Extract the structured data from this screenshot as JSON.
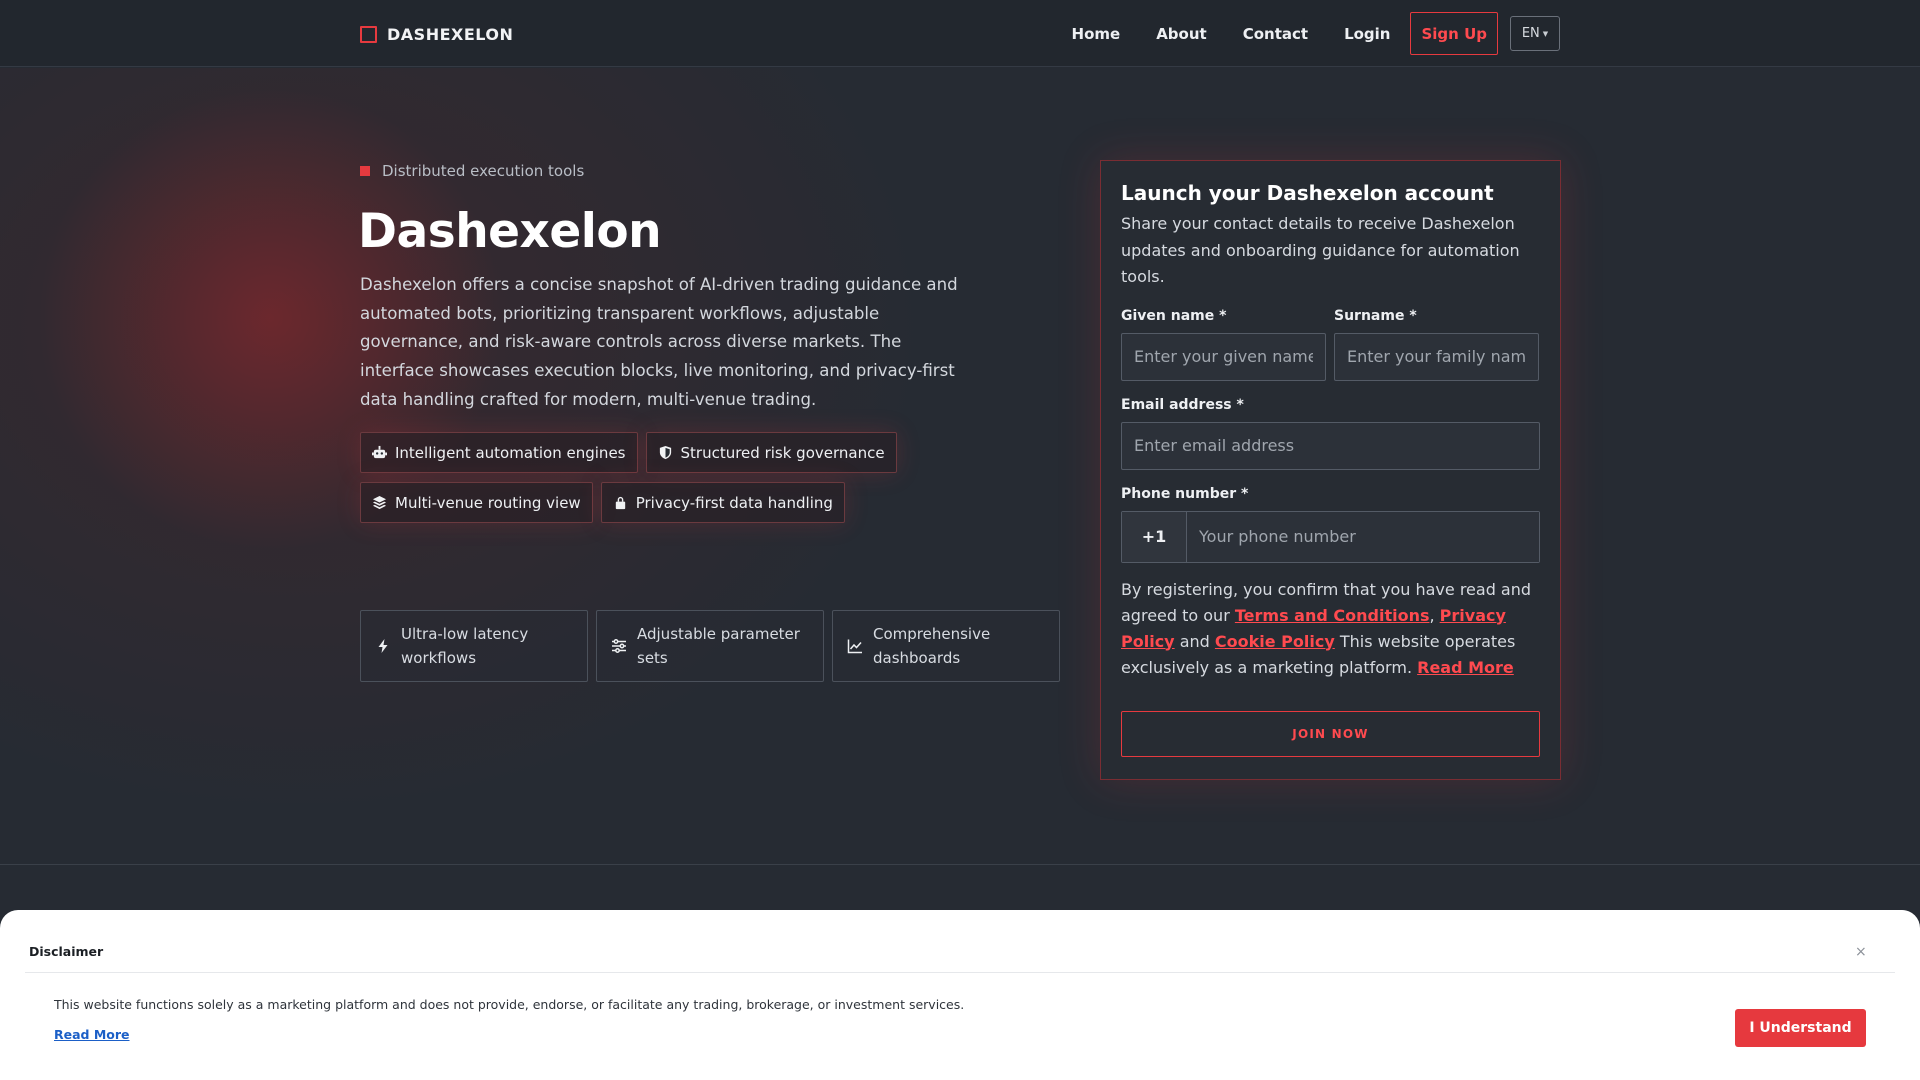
{
  "header": {
    "brand": "DASHEXELON",
    "nav": [
      "Home",
      "About",
      "Contact",
      "Login"
    ],
    "signup": "Sign Up",
    "language": "EN"
  },
  "hero": {
    "eyebrow": "Distributed execution tools",
    "title": "Dashexelon",
    "description": "Dashexelon offers a concise snapshot of AI-driven trading guidance and automated bots, prioritizing transparent workflows, adjustable governance, and risk-aware controls across diverse markets. The interface showcases execution blocks, live monitoring, and privacy-first data handling crafted for modern, multi-venue trading.",
    "chips": [
      {
        "label": "Intelligent automation engines",
        "icon": "robot-icon"
      },
      {
        "label": "Structured risk governance",
        "icon": "shield-icon"
      },
      {
        "label": "Multi-venue routing view",
        "icon": "layers-icon"
      },
      {
        "label": "Privacy-first data handling",
        "icon": "lock-icon"
      }
    ],
    "features": [
      {
        "label": "Ultra-low latency workflows",
        "icon": "bolt-icon"
      },
      {
        "label": "Adjustable parameter sets",
        "icon": "sliders-icon"
      },
      {
        "label": "Comprehensive dashboards",
        "icon": "chart-line-icon"
      }
    ]
  },
  "form": {
    "title": "Launch your Dashexelon account",
    "subtitle": "Share your contact details to receive Dashexelon updates and onboarding guidance for automation tools.",
    "given_name_label": "Given name *",
    "given_name_placeholder": "Enter your given name",
    "surname_label": "Surname *",
    "surname_placeholder": "Enter your family name",
    "email_label": "Email address *",
    "email_placeholder": "Enter email address",
    "phone_label": "Phone number *",
    "phone_code": "+1",
    "phone_placeholder": "Your phone number",
    "consent_prefix": "By registering, you confirm that you have read and agreed to our",
    "terms_link": "Terms and Conditions",
    "privacy_link": "Privacy Policy",
    "consent_and": "and",
    "cookie_link": "Cookie Policy",
    "consent_suffix": "This website operates exclusively as a marketing platform.",
    "read_more": "Read More",
    "submit": "JOIN NOW"
  },
  "disclaimer": {
    "title": "Disclaimer",
    "close": "×",
    "text": "This website functions solely as a marketing platform and does not provide, endorse, or facilitate any trading, brokerage, or investment services.",
    "read_more": "Read More",
    "accept": "I Understand"
  },
  "colors": {
    "accent": "#e63a3f",
    "background": "#262b33",
    "header": "#22272e",
    "link_blue": "#1b5fc7"
  }
}
